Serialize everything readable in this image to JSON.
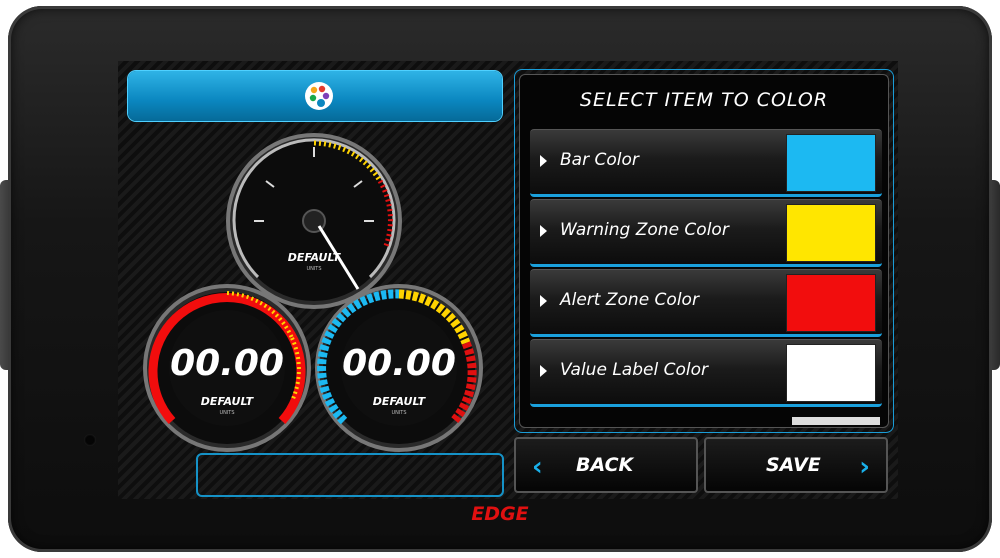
{
  "header": {
    "icon": "palette-icon"
  },
  "gauges": [
    {
      "label": "DEFAULT",
      "units": "UNITS",
      "value": ""
    },
    {
      "label": "DEFAULT",
      "units": "UNITS",
      "value": "00.00"
    },
    {
      "label": "DEFAULT",
      "units": "UNITS",
      "value": "00.00"
    }
  ],
  "panel": {
    "title": "SELECT ITEM TO COLOR",
    "items": [
      {
        "label": "Bar Color",
        "color": "#1cb9f2"
      },
      {
        "label": "Warning Zone Color",
        "color": "#ffe600"
      },
      {
        "label": "Alert Zone Color",
        "color": "#f20d0d"
      },
      {
        "label": "Value Label Color",
        "color": "#ffffff"
      }
    ]
  },
  "buttons": {
    "back": "BACK",
    "save": "SAVE"
  },
  "logo": {
    "text": "EDGE"
  },
  "colors": {
    "accent": "#1aa0dc"
  }
}
